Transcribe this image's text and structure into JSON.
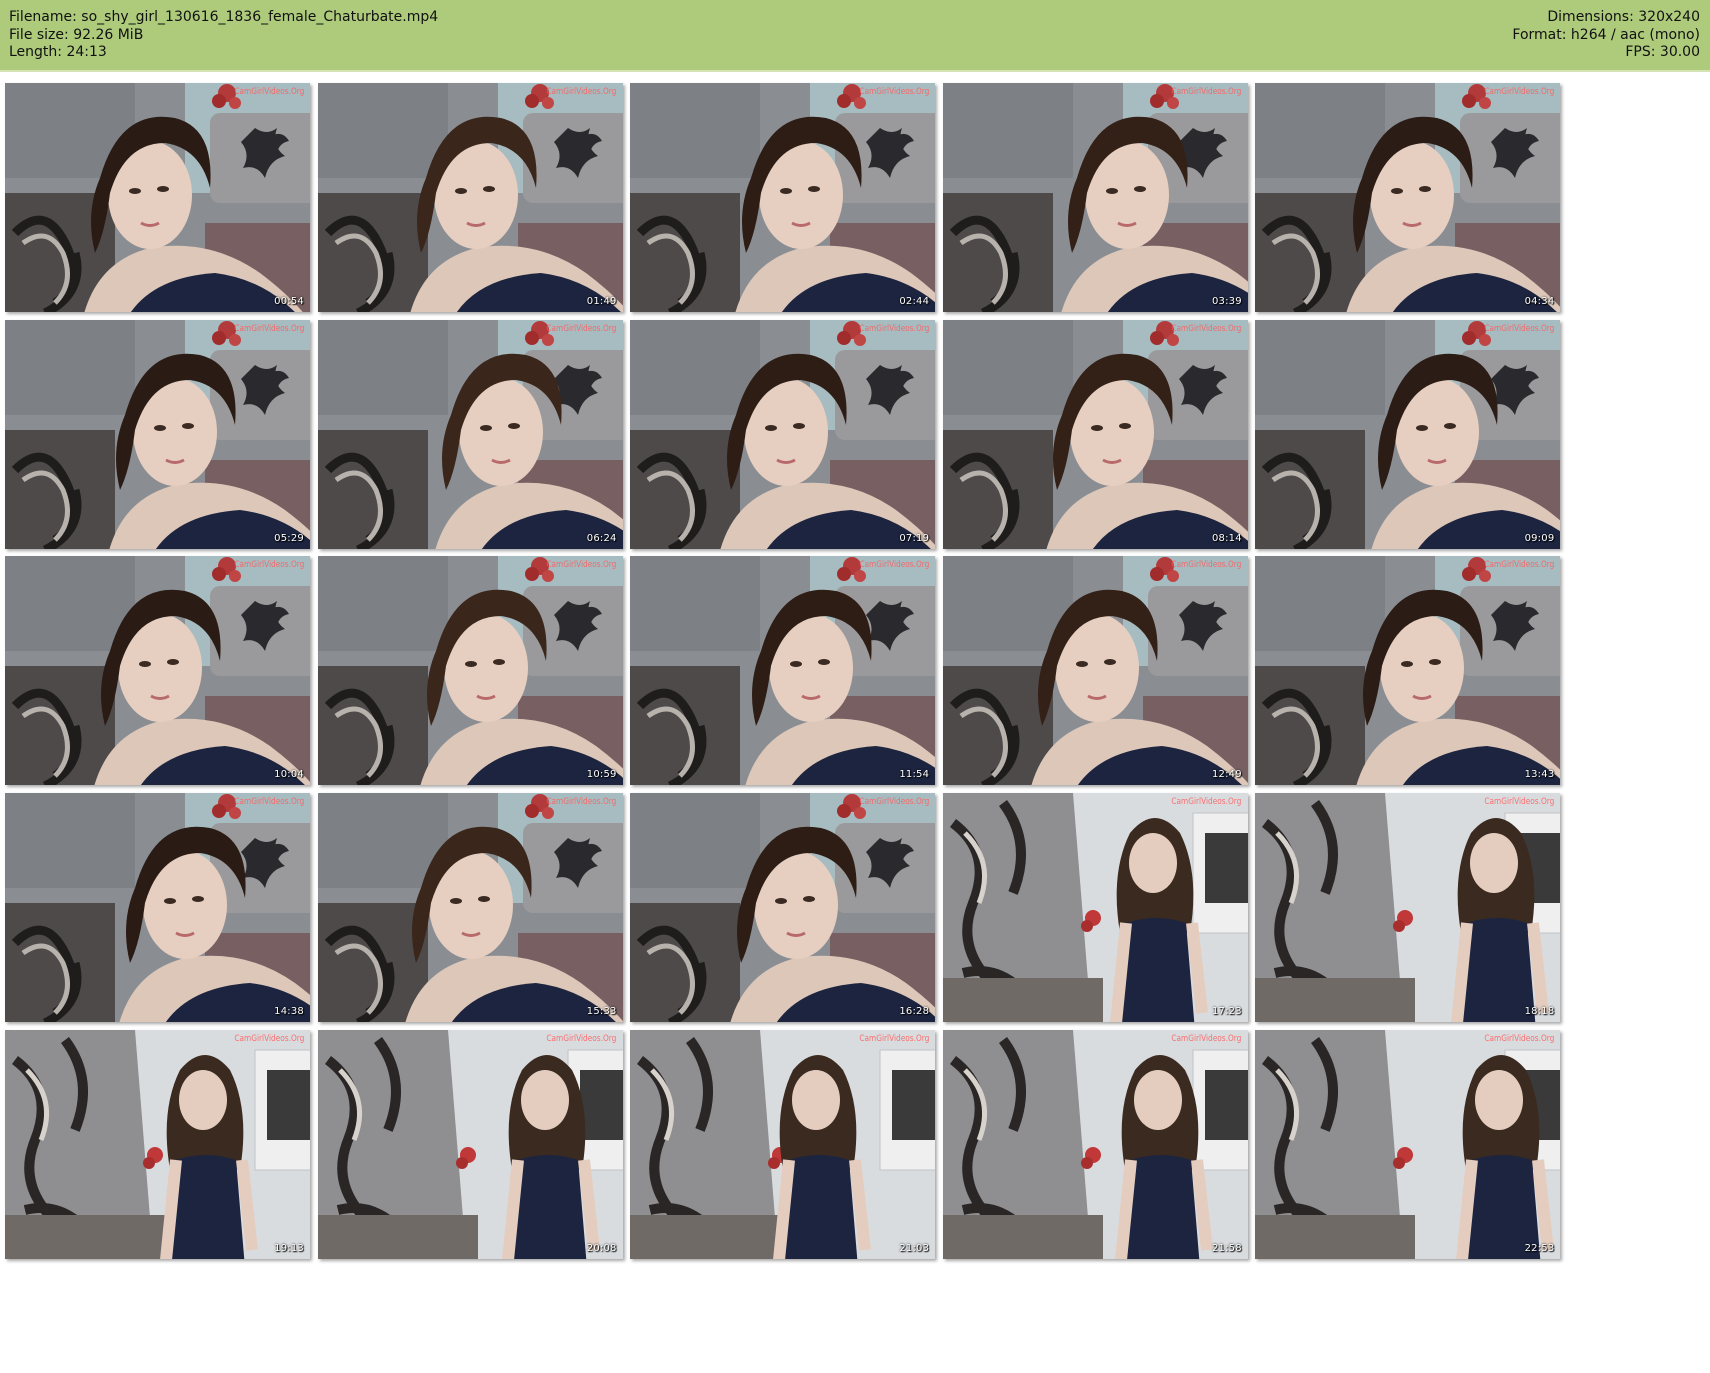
{
  "header": {
    "filename": "Filename: so_shy_girl_130616_1836_female_Chaturbate.mp4",
    "filesize": "File size: 92.26 MiB",
    "length": "Length: 24:13",
    "dimensions": "Dimensions: 320x240",
    "format": "Format: h264 / aac (mono)",
    "fps": "FPS: 30.00",
    "background": "#aecb7c"
  },
  "watermark": "CamGirlVideos.Org",
  "thumbnails": [
    {
      "time": "00:54",
      "scene": "couch"
    },
    {
      "time": "01:49",
      "scene": "couch"
    },
    {
      "time": "02:44",
      "scene": "couch"
    },
    {
      "time": "03:39",
      "scene": "couch"
    },
    {
      "time": "04:34",
      "scene": "couch"
    },
    {
      "time": "05:29",
      "scene": "couch"
    },
    {
      "time": "06:24",
      "scene": "couch"
    },
    {
      "time": "07:19",
      "scene": "couch"
    },
    {
      "time": "08:14",
      "scene": "couch"
    },
    {
      "time": "09:09",
      "scene": "couch"
    },
    {
      "time": "10:04",
      "scene": "couch"
    },
    {
      "time": "10:59",
      "scene": "couch"
    },
    {
      "time": "11:54",
      "scene": "couch"
    },
    {
      "time": "12:49",
      "scene": "couch"
    },
    {
      "time": "13:43",
      "scene": "couch"
    },
    {
      "time": "14:38",
      "scene": "couch"
    },
    {
      "time": "15:33",
      "scene": "couch"
    },
    {
      "time": "16:28",
      "scene": "couch"
    },
    {
      "time": "17:23",
      "scene": "room"
    },
    {
      "time": "18:18",
      "scene": "room"
    },
    {
      "time": "19:13",
      "scene": "room"
    },
    {
      "time": "20:08",
      "scene": "room"
    },
    {
      "time": "21:03",
      "scene": "room"
    },
    {
      "time": "21:58",
      "scene": "room"
    },
    {
      "time": "22:53",
      "scene": "room"
    }
  ]
}
